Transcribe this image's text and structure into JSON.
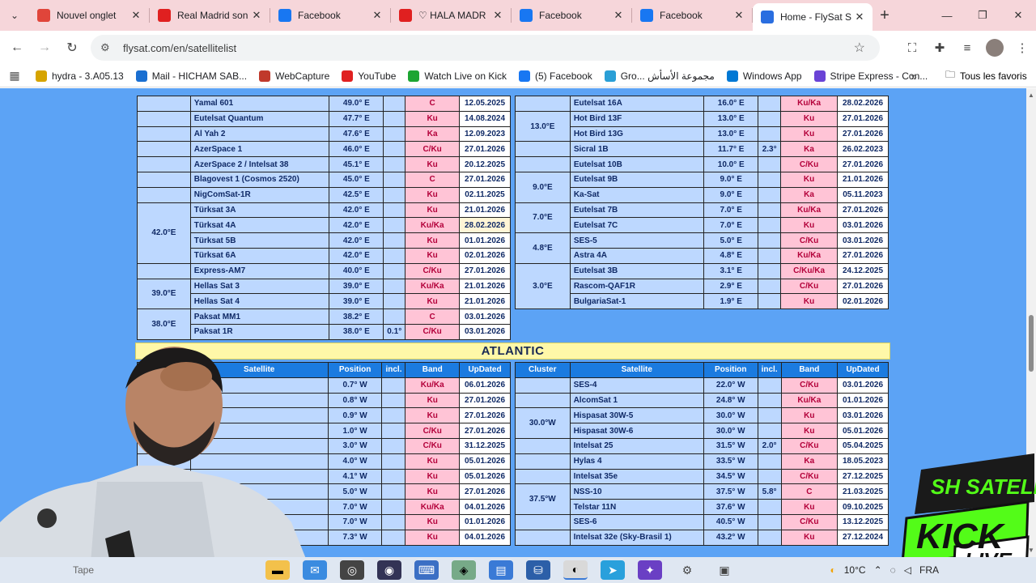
{
  "browser": {
    "tabs": [
      {
        "title": "Nouvel onglet",
        "icon": "chrome-icon",
        "color": "#e0453a"
      },
      {
        "title": "Real Madrid son",
        "icon": "youtube-icon",
        "color": "#e02020"
      },
      {
        "title": "Facebook",
        "icon": "facebook-icon",
        "color": "#1877f2"
      },
      {
        "title": "♡ HALA MADR",
        "icon": "youtube-icon",
        "color": "#e02020"
      },
      {
        "title": "Facebook",
        "icon": "facebook-icon",
        "color": "#1877f2"
      },
      {
        "title": "Facebook",
        "icon": "facebook-icon",
        "color": "#1877f2"
      },
      {
        "title": "Home - FlySat S",
        "icon": "flysat-icon",
        "color": "#2a6ee0"
      }
    ],
    "url": "flysat.com/en/satellitelist",
    "bookmarks": [
      {
        "label": "hydra - 3.A05.13",
        "icon": "hydra-icon",
        "color": "#d6a400"
      },
      {
        "label": "Mail - HICHAM SAB...",
        "icon": "outlook-icon",
        "color": "#1a6fd1"
      },
      {
        "label": "WebCapture",
        "icon": "webcapture-icon",
        "color": "#c0392b"
      },
      {
        "label": "YouTube",
        "icon": "youtube-icon",
        "color": "#e02020"
      },
      {
        "label": "Watch Live on Kick",
        "icon": "kick-icon",
        "color": "#1da532"
      },
      {
        "label": "(5) Facebook",
        "icon": "facebook-icon",
        "color": "#1877f2"
      },
      {
        "label": "Gro... مجموعة الأسأش",
        "icon": "telegram-icon",
        "color": "#2a9fd6"
      },
      {
        "label": "Windows App",
        "icon": "windows-icon",
        "color": "#0078d4"
      },
      {
        "label": "Stripe Express - Con...",
        "icon": "stripe-icon",
        "color": "#6a43d6"
      }
    ],
    "all_bookmarks": "Tous les favoris"
  },
  "upper_left_rows": [
    {
      "cluster": "",
      "name": "Yamal 601",
      "pos": "49.0° E",
      "incl": "",
      "band": "C",
      "date": "12.05.2025"
    },
    {
      "cluster": "",
      "name": "Eutelsat Quantum",
      "pos": "47.7° E",
      "incl": "",
      "band": "Ku",
      "date": "14.08.2024"
    },
    {
      "cluster": "",
      "name": "Al Yah 2",
      "pos": "47.6° E",
      "incl": "",
      "band": "Ka",
      "date": "12.09.2023"
    },
    {
      "cluster": "",
      "name": "AzerSpace 1",
      "pos": "46.0° E",
      "incl": "",
      "band": "C/Ku",
      "date": "27.01.2026"
    },
    {
      "cluster": "",
      "name": "AzerSpace 2 / Intelsat 38",
      "pos": "45.1° E",
      "incl": "",
      "band": "Ku",
      "date": "20.12.2025"
    },
    {
      "cluster": "",
      "name": "Blagovest 1 (Cosmos 2520)",
      "pos": "45.0° E",
      "incl": "",
      "band": "C",
      "date": "27.01.2026"
    },
    {
      "cluster": "",
      "name": "NigComSat-1R",
      "pos": "42.5° E",
      "incl": "",
      "band": "Ku",
      "date": "02.11.2025"
    },
    {
      "cluster": "42.0°E",
      "name": "Türksat 3A",
      "pos": "42.0° E",
      "incl": "",
      "band": "Ku",
      "date": "21.01.2026"
    },
    {
      "cluster": "",
      "name": "Türksat 4A",
      "pos": "42.0° E",
      "incl": "",
      "band": "Ku/Ka",
      "date": "28.02.2026"
    },
    {
      "cluster": "",
      "name": "Türksat 5B",
      "pos": "42.0° E",
      "incl": "",
      "band": "Ku",
      "date": "01.01.2026"
    },
    {
      "cluster": "",
      "name": "Türksat 6A",
      "pos": "42.0° E",
      "incl": "",
      "band": "Ku",
      "date": "02.01.2026"
    },
    {
      "cluster": "",
      "name": "Express-AM7",
      "pos": "40.0° E",
      "incl": "",
      "band": "C/Ku",
      "date": "27.01.2026"
    },
    {
      "cluster": "39.0°E",
      "name": "Hellas Sat 3",
      "pos": "39.0° E",
      "incl": "",
      "band": "Ku/Ka",
      "date": "21.01.2026"
    },
    {
      "cluster": "",
      "name": "Hellas Sat 4",
      "pos": "39.0° E",
      "incl": "",
      "band": "Ku",
      "date": "21.01.2026"
    },
    {
      "cluster": "38.0°E",
      "name": "Paksat MM1",
      "pos": "38.2° E",
      "incl": "",
      "band": "C",
      "date": "03.01.2026"
    },
    {
      "cluster": "",
      "name": "Paksat 1R",
      "pos": "38.0° E",
      "incl": "0.1°",
      "band": "C/Ku",
      "date": "03.01.2026"
    }
  ],
  "upper_right_rows": [
    {
      "cluster": "",
      "name": "Eutelsat 16A",
      "pos": "16.0° E",
      "incl": "",
      "band": "Ku/Ka",
      "date": "28.02.2026"
    },
    {
      "cluster": "13.0°E",
      "name": "Hot Bird 13F",
      "pos": "13.0° E",
      "incl": "",
      "band": "Ku",
      "date": "27.01.2026"
    },
    {
      "cluster": "",
      "name": "Hot Bird 13G",
      "pos": "13.0° E",
      "incl": "",
      "band": "Ku",
      "date": "27.01.2026"
    },
    {
      "cluster": "",
      "name": "Sicral 1B",
      "pos": "11.7° E",
      "incl": "2.3°",
      "band": "Ka",
      "date": "26.02.2023"
    },
    {
      "cluster": "",
      "name": "Eutelsat 10B",
      "pos": "10.0° E",
      "incl": "",
      "band": "C/Ku",
      "date": "27.01.2026"
    },
    {
      "cluster": "9.0°E",
      "name": "Eutelsat 9B",
      "pos": "9.0° E",
      "incl": "",
      "band": "Ku",
      "date": "21.01.2026"
    },
    {
      "cluster": "",
      "name": "Ka-Sat",
      "pos": "9.0° E",
      "incl": "",
      "band": "Ka",
      "date": "05.11.2023"
    },
    {
      "cluster": "7.0°E",
      "name": "Eutelsat 7B",
      "pos": "7.0° E",
      "incl": "",
      "band": "Ku/Ka",
      "date": "27.01.2026"
    },
    {
      "cluster": "",
      "name": "Eutelsat 7C",
      "pos": "7.0° E",
      "incl": "",
      "band": "Ku",
      "date": "03.01.2026"
    },
    {
      "cluster": "4.8°E",
      "name": "SES-5",
      "pos": "5.0° E",
      "incl": "",
      "band": "C/Ku",
      "date": "03.01.2026"
    },
    {
      "cluster": "",
      "name": "Astra 4A",
      "pos": "4.8° E",
      "incl": "",
      "band": "Ku/Ka",
      "date": "27.01.2026"
    },
    {
      "cluster": "3.0°E",
      "name": "Eutelsat 3B",
      "pos": "3.1° E",
      "incl": "",
      "band": "C/Ku/Ka",
      "date": "24.12.2025"
    },
    {
      "cluster": "",
      "name": "Rascom-QAF1R",
      "pos": "2.9° E",
      "incl": "",
      "band": "C/Ku",
      "date": "27.01.2026"
    },
    {
      "cluster": "",
      "name": "BulgariaSat-1",
      "pos": "1.9° E",
      "incl": "",
      "band": "Ku",
      "date": "02.01.2026"
    }
  ],
  "region_title": "ATLANTIC",
  "headers": {
    "cluster": "Cluster",
    "satellite": "Satellite",
    "position": "Position",
    "incl": "incl.",
    "band": "Band",
    "updated": "UpDated"
  },
  "lower_left_rows": [
    {
      "name": "7",
      "pos": "0.7° W",
      "incl": "",
      "band": "Ku/Ka",
      "date": "06.01.2026"
    },
    {
      "name": "",
      "pos": "0.8° W",
      "incl": "",
      "band": "Ku",
      "date": "27.01.2026"
    },
    {
      "name": "",
      "pos": "0.9° W",
      "incl": "",
      "band": "Ku",
      "date": "27.01.2026"
    },
    {
      "name": "-02",
      "pos": "1.0° W",
      "incl": "",
      "band": "C/Ku",
      "date": "27.01.2026"
    },
    {
      "name": "",
      "pos": "3.0° W",
      "incl": "",
      "band": "C/Ku",
      "date": "31.12.2025"
    },
    {
      "name": "",
      "pos": "4.0° W",
      "incl": "",
      "band": "Ku",
      "date": "05.01.2026"
    },
    {
      "name": "",
      "pos": "4.1° W",
      "incl": "",
      "band": "Ku",
      "date": "05.01.2026"
    },
    {
      "name": "",
      "pos": "5.0° W",
      "incl": "",
      "band": "Ku",
      "date": "27.01.2026"
    },
    {
      "name": "",
      "pos": "7.0° W",
      "incl": "",
      "band": "Ku/Ka",
      "date": "04.01.2026"
    },
    {
      "name": "",
      "pos": "7.0° W",
      "incl": "",
      "band": "Ku",
      "date": "01.01.2026"
    },
    {
      "name": "7 West A",
      "pos": "7.3° W",
      "incl": "",
      "band": "Ku",
      "date": "04.01.2026"
    }
  ],
  "lower_right_rows": [
    {
      "cluster": "",
      "name": "SES-4",
      "pos": "22.0° W",
      "incl": "",
      "band": "C/Ku",
      "date": "03.01.2026"
    },
    {
      "cluster": "",
      "name": "AlcomSat 1",
      "pos": "24.8° W",
      "incl": "",
      "band": "Ku/Ka",
      "date": "01.01.2026"
    },
    {
      "cluster": "30.0°W",
      "name": "Hispasat 30W-5",
      "pos": "30.0° W",
      "incl": "",
      "band": "Ku",
      "date": "03.01.2026"
    },
    {
      "cluster": "",
      "name": "Hispasat 30W-6",
      "pos": "30.0° W",
      "incl": "",
      "band": "Ku",
      "date": "05.01.2026"
    },
    {
      "cluster": "",
      "name": "Intelsat 25",
      "pos": "31.5° W",
      "incl": "2.0°",
      "band": "C/Ku",
      "date": "05.04.2025"
    },
    {
      "cluster": "",
      "name": "Hylas 4",
      "pos": "33.5° W",
      "incl": "",
      "band": "Ka",
      "date": "18.05.2023"
    },
    {
      "cluster": "",
      "name": "Intelsat 35e",
      "pos": "34.5° W",
      "incl": "",
      "band": "C/Ku",
      "date": "27.12.2025"
    },
    {
      "cluster": "37.5°W",
      "name": "NSS-10",
      "pos": "37.5° W",
      "incl": "5.8°",
      "band": "C",
      "date": "21.03.2025"
    },
    {
      "cluster": "",
      "name": "Telstar 11N",
      "pos": "37.6° W",
      "incl": "",
      "band": "Ku",
      "date": "09.10.2025"
    },
    {
      "cluster": "",
      "name": "SES-6",
      "pos": "40.5° W",
      "incl": "",
      "band": "C/Ku",
      "date": "13.12.2025"
    },
    {
      "cluster": "",
      "name": "Intelsat 32e (Sky-Brasil 1)",
      "pos": "43.2° W",
      "incl": "",
      "band": "Ku",
      "date": "27.12.2024"
    }
  ],
  "taskbar": {
    "search_placeholder": "Tape",
    "weather": "10°C",
    "lang": "FRA"
  },
  "overlay": {
    "kick_top": "SH SATELLITE",
    "kick_mid": "KICK",
    "kick_live": "LIVE"
  }
}
